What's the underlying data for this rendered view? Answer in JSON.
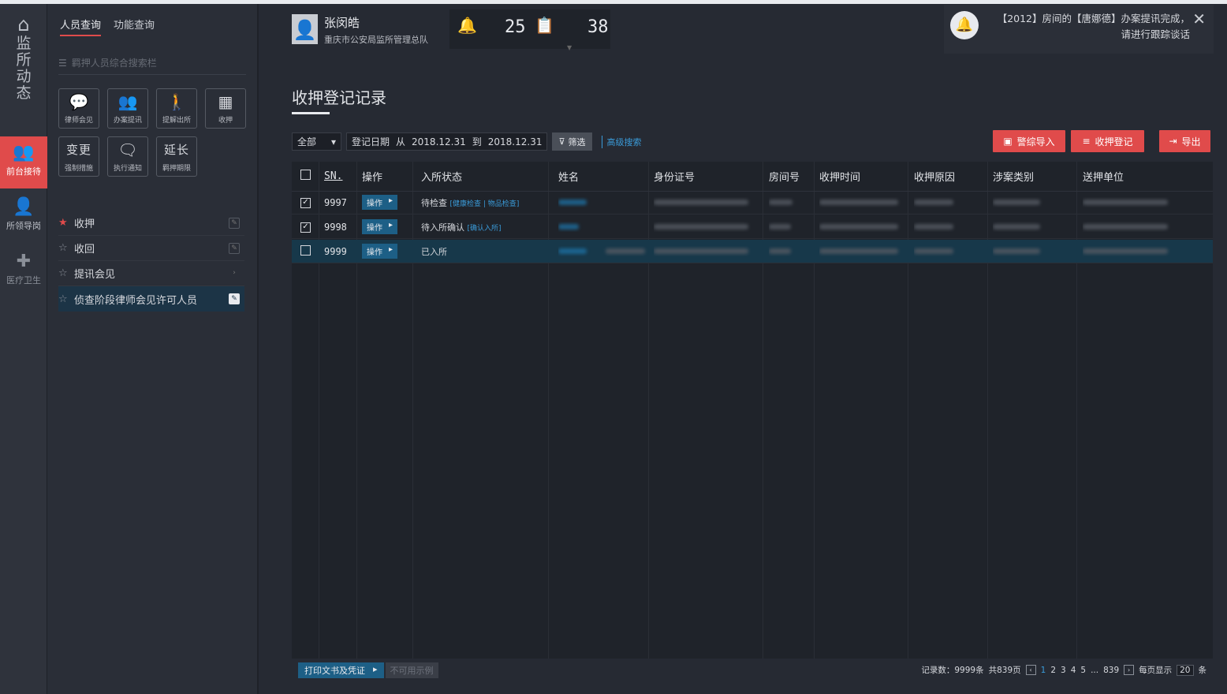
{
  "rail": {
    "home_label": "监所动态",
    "items": [
      {
        "label": "前台接待",
        "icon": "reception-icon"
      },
      {
        "label": "所领导岗",
        "icon": "leader-icon"
      },
      {
        "label": "医疗卫生",
        "icon": "medical-kit-icon"
      }
    ]
  },
  "panel": {
    "tabs": [
      "人员查询",
      "功能查询"
    ],
    "search_placeholder": "羁押人员综合搜索栏",
    "tiles": [
      {
        "label": "律师会见",
        "icon": "chat-bubbles-icon"
      },
      {
        "label": "办案提讯",
        "icon": "people-icon"
      },
      {
        "label": "提解出所",
        "icon": "escort-icon"
      },
      {
        "label": "收押",
        "icon": "detain-icon"
      },
      {
        "big": "变更",
        "label": "强制措施"
      },
      {
        "label": "执行通知",
        "icon": "message-icon"
      },
      {
        "big": "延长",
        "label": "羁押期限"
      }
    ],
    "favorites": [
      {
        "label": "收押"
      },
      {
        "label": "收回"
      },
      {
        "label": "提讯会见"
      },
      {
        "label": "侦查阶段律师会见许可人员"
      }
    ]
  },
  "header": {
    "user_name": "张闵皓",
    "user_org": "重庆市公安局监所管理总队",
    "count_alerts": "25",
    "count_tasks": "38"
  },
  "notification": {
    "text": "【2012】房间的【唐娜德】办案提讯完成，请进行跟踪谈话"
  },
  "main": {
    "title": "收押登记记录",
    "filter": {
      "select_value": "全部",
      "date_label": "登记日期",
      "from_label": "从",
      "from_date": "2018.12.31",
      "to_label": "到",
      "to_date": "2018.12.31",
      "filter_button": "筛选",
      "advanced_link": "高级搜索"
    },
    "actions": {
      "import": "警综导入",
      "register": "收押登记",
      "export": "导出"
    },
    "table": {
      "headers": [
        "SN.",
        "操作",
        "入所状态",
        "姓名",
        "身份证号",
        "房间号",
        "收押时间",
        "收押原因",
        "涉案类别",
        "送押单位"
      ],
      "op_label": "操作",
      "rows": [
        {
          "checked": true,
          "sn": "9997",
          "status": "待检查",
          "links": [
            "健康检查",
            "物品检查"
          ]
        },
        {
          "checked": true,
          "sn": "9998",
          "status": "待入所确认",
          "links": [
            "确认入所"
          ]
        },
        {
          "checked": false,
          "sn": "9999",
          "status": "已入所",
          "links": []
        }
      ]
    },
    "bottom": {
      "print_button": "打印文书及凭证",
      "disabled_button": "不可用示例",
      "record_count": "记录数：9999条",
      "page_total": "共839页",
      "pages": [
        "1",
        "2",
        "3",
        "4",
        "5"
      ],
      "ellipsis": "...",
      "last_page": "839",
      "per_page_label": "每页显示",
      "per_page_value": "20",
      "per_page_unit": "条"
    }
  },
  "colors": {
    "accent_red": "#e04b4b",
    "link_blue": "#3a9bd9",
    "selected_row": "#17384a"
  }
}
